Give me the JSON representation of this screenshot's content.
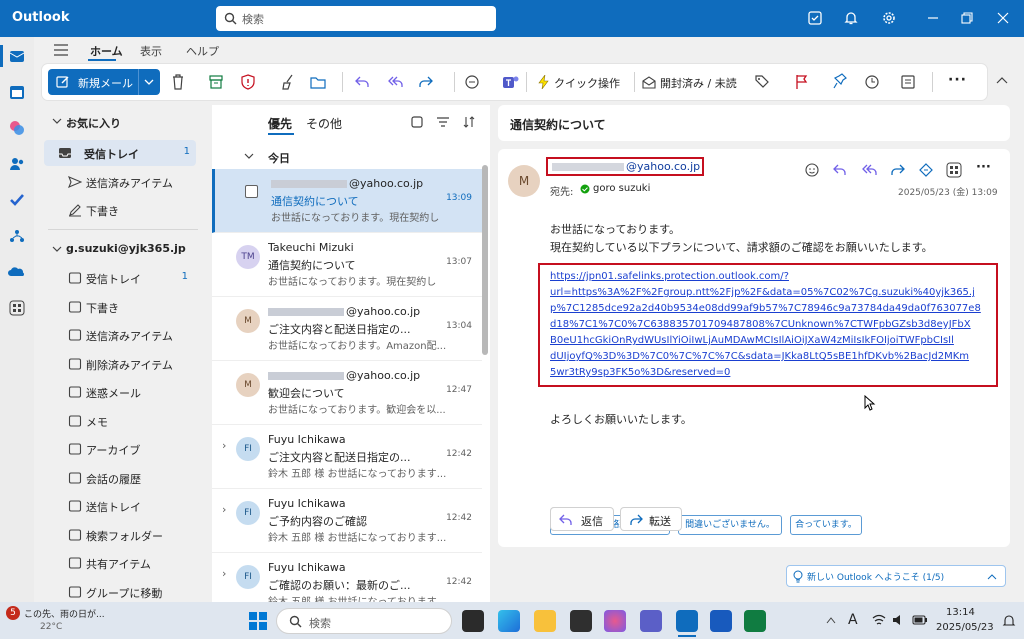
{
  "titlebar": {
    "app": "Outlook",
    "search_placeholder": "検索"
  },
  "menu": {
    "tabs": [
      "ホーム",
      "表示",
      "ヘルプ"
    ]
  },
  "ribbon": {
    "new_mail": "新規メール",
    "quick_steps": "クイック操作",
    "read_unread": "開封済み / 未読"
  },
  "folders": {
    "favorites_header": "お気に入り",
    "favorites": [
      {
        "label": "受信トレイ",
        "count": "1"
      },
      {
        "label": "送信済みアイテム",
        "count": ""
      },
      {
        "label": "下書き",
        "count": ""
      }
    ],
    "account": "g.suzuki@yjk365.jp",
    "items": [
      {
        "label": "受信トレイ",
        "count": "1"
      },
      {
        "label": "下書き",
        "count": ""
      },
      {
        "label": "送信済みアイテム",
        "count": ""
      },
      {
        "label": "削除済みアイテム",
        "count": ""
      },
      {
        "label": "迷惑メール",
        "count": ""
      },
      {
        "label": "メモ",
        "count": ""
      },
      {
        "label": "アーカイブ",
        "count": ""
      },
      {
        "label": "会話の履歴",
        "count": ""
      },
      {
        "label": "送信トレイ",
        "count": ""
      },
      {
        "label": "検索フォルダー",
        "count": ""
      },
      {
        "label": "共有アイテム",
        "count": ""
      },
      {
        "label": "グループに移動",
        "count": ""
      }
    ]
  },
  "list": {
    "tab_focused": "優先",
    "tab_other": "その他",
    "group_today": "今日",
    "messages": [
      {
        "sender": "@yahoo.co.jp",
        "subject": "通信契約について",
        "time": "13:09",
        "preview": "お世話になっております。現在契約し",
        "avatar": ""
      },
      {
        "sender": "Takeuchi Mizuki",
        "subject": "通信契約について",
        "time": "13:07",
        "preview": "お世話になっております。現在契約し",
        "avatar": "TM"
      },
      {
        "sender": "@yahoo.co.jp",
        "subject": "ご注文内容と配送日指定の...",
        "time": "13:04",
        "preview": "お世話になっております。Amazon配...",
        "avatar": "M"
      },
      {
        "sender": "@yahoo.co.jp",
        "subject": "歓迎会について",
        "time": "12:47",
        "preview": "お世話になっております。歓迎会を以...",
        "avatar": "M"
      },
      {
        "sender": "Fuyu Ichikawa",
        "subject": "ご注文内容と配送日指定の...",
        "time": "12:42",
        "preview": "鈴木 五郎 様 お世話になっております...",
        "avatar": "FI"
      },
      {
        "sender": "Fuyu Ichikawa",
        "subject": "ご予約内容のご確認",
        "time": "12:42",
        "preview": "鈴木 五郎 様 お世話になっております...",
        "avatar": "FI"
      },
      {
        "sender": "Fuyu Ichikawa",
        "subject": "ご確認のお願い：最新のご...",
        "time": "12:42",
        "preview": "鈴木 五郎 様 お世話になっております...",
        "avatar": "FI"
      }
    ]
  },
  "reading": {
    "subject": "通信契約について",
    "from": "@yahoo.co.jp",
    "to_label": "宛先:",
    "to": "goro suzuki",
    "date": "2025/05/23 (金) 13:09",
    "avatar": "M",
    "body1": "お世話になっております。",
    "body2": "現在契約している以下プランについて、請求額のご確認をお願いいたします。",
    "link_lines": [
      "https://jpn01.safelinks.protection.outlook.com/?",
      "url=https%3A%2F%2Fgroup.ntt%2Fjp%2F&data=05%7C02%7Cg.suzuki%40yjk365.j",
      "p%7C1285dce92a2d40b9534e08dd99af9b57%7C78946c9a73784da49da0f763077e8",
      "d18%7C1%7C0%7C638835701709487808%7CUnknown%7CTWFpbGZsb3d8eyJFbX",
      "B0eU1hcGkiOnRydWUsIlYiOiIwLjAuMDAwMCIsIlAiOiJXaW4zMiIsIkFOIjoiTWFpbCIsIl",
      "dUIjoyfQ%3D%3D%7C0%7C%7C%7C&sdata=JKka8LtQ5sBE1hfDKvb%2BacJd2MKm",
      "5wr3tRy9sp3FK5o%3D&reserved=0"
    ],
    "closing": "よろしくお願いいたします。",
    "suggest": [
      "確認してご連絡致します。",
      "間違いございません。",
      "合っています。"
    ],
    "reply": "返信",
    "forward": "転送"
  },
  "banner": "新しい Outlook へようこそ (1/5)",
  "taskbar": {
    "weather_line1": "この先、雨の日が...",
    "weather_line2": "22°C",
    "notif_count": "5",
    "search": "検索",
    "ime": "A",
    "time": "13:14",
    "date": "2025/05/23"
  },
  "colors": {
    "accent": "#0f6cbd",
    "flag": "#c50f1f",
    "highlight_box": "#c50f1f"
  }
}
